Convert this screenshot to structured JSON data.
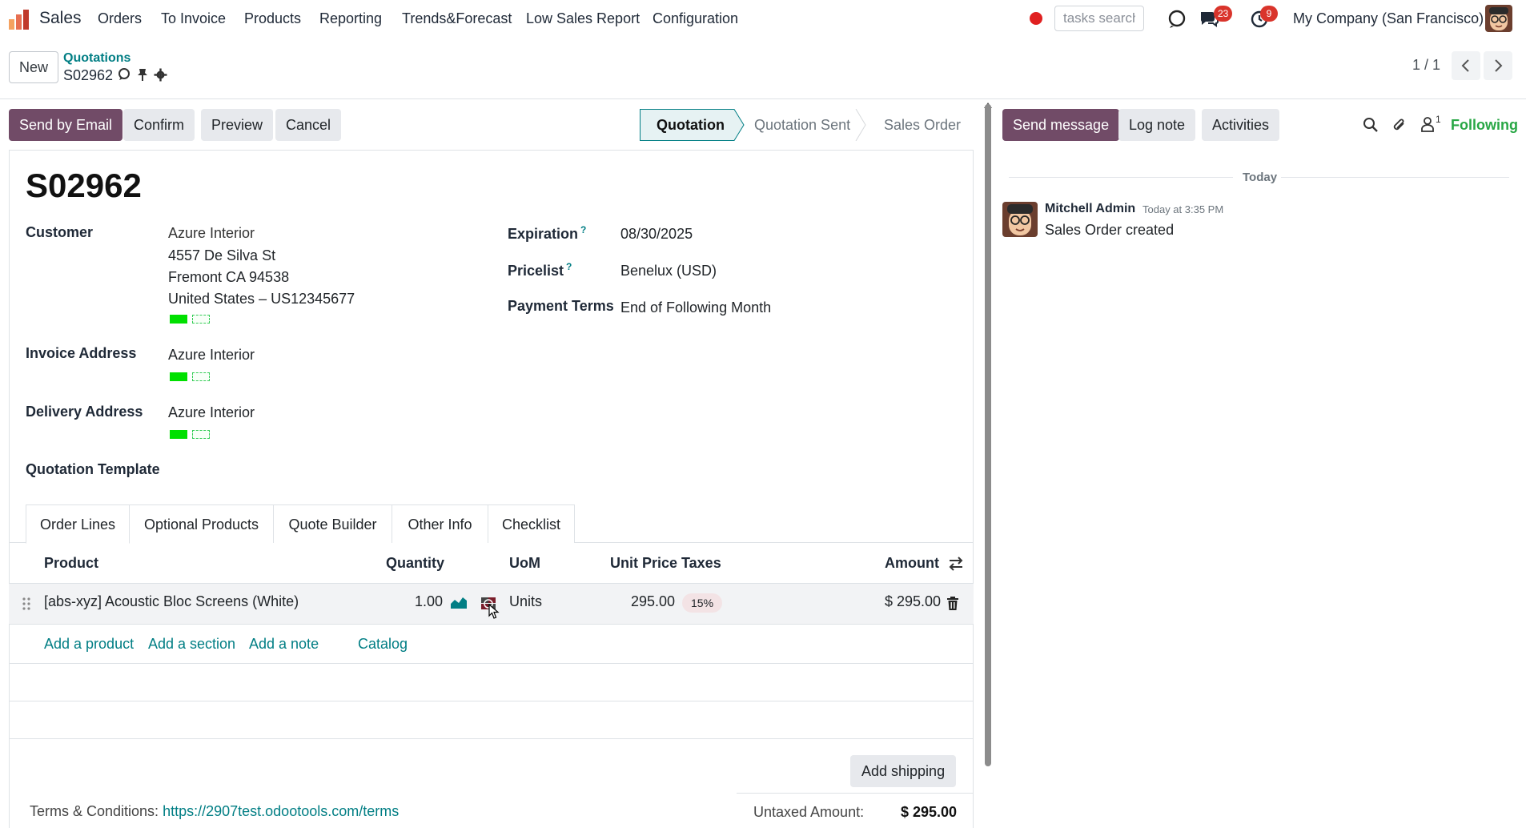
{
  "app": {
    "name": "Sales"
  },
  "nav": {
    "menu": [
      "Orders",
      "To Invoice",
      "Products",
      "Reporting",
      "Trends&Forecast",
      "Low Sales Report",
      "Configuration"
    ],
    "tasks_search_placeholder": "tasks search",
    "messages_badge": "23",
    "activities_badge": "9",
    "company": "My Company (San Francisco)"
  },
  "control_panel": {
    "new_label": "New",
    "breadcrumb_parent": "Quotations",
    "breadcrumb_current": "S02962",
    "pager": "1 / 1"
  },
  "actions": {
    "send_by_email": "Send by Email",
    "confirm": "Confirm",
    "preview": "Preview",
    "cancel": "Cancel"
  },
  "statusbar": {
    "stages": [
      "Quotation",
      "Quotation Sent",
      "Sales Order"
    ],
    "active": "Quotation"
  },
  "form": {
    "title": "S02962",
    "customer_label": "Customer",
    "customer": {
      "name": "Azure Interior",
      "street": "4557 De Silva St",
      "city": "Fremont CA 94538",
      "country_vat": "United States – US12345677"
    },
    "invoice_address_label": "Invoice Address",
    "invoice_address": "Azure Interior",
    "delivery_address_label": "Delivery Address",
    "delivery_address": "Azure Interior",
    "quotation_template_label": "Quotation Template",
    "expiration_label": "Expiration",
    "expiration": "08/30/2025",
    "pricelist_label": "Pricelist",
    "pricelist": "Benelux (USD)",
    "payment_terms_label": "Payment Terms",
    "payment_terms": "End of Following Month",
    "help_mark": "?"
  },
  "tabs": [
    "Order Lines",
    "Optional Products",
    "Quote Builder",
    "Other Info",
    "Checklist"
  ],
  "order_lines": {
    "headers": {
      "product": "Product",
      "quantity": "Quantity",
      "uom": "UoM",
      "unit_price": "Unit Price",
      "taxes": "Taxes",
      "amount": "Amount"
    },
    "rows": [
      {
        "product": "[abs-xyz] Acoustic Bloc Screens (White)",
        "quantity": "1.00",
        "uom": "Units",
        "unit_price": "295.00",
        "taxes": "15%",
        "amount": "$ 295.00"
      }
    ],
    "add_product": "Add a product",
    "add_section": "Add a section",
    "add_note": "Add a note",
    "catalog": "Catalog"
  },
  "footer": {
    "add_shipping": "Add shipping",
    "terms_label": "Terms & Conditions:",
    "terms_link": "https://2907test.odootools.com/terms",
    "untaxed_label": "Untaxed Amount:",
    "untaxed_value": "$ 295.00"
  },
  "chatter": {
    "send_message": "Send message",
    "log_note": "Log note",
    "activities": "Activities",
    "followers_count": "1",
    "following": "Following",
    "today": "Today",
    "messages": [
      {
        "author": "Mitchell Admin",
        "date": "Today at 3:35 PM",
        "body": "Sales Order created"
      }
    ]
  },
  "colors": {
    "primary": "#714b67",
    "link": "#017e84",
    "following": "#28a745",
    "badge": "#d9342b"
  }
}
